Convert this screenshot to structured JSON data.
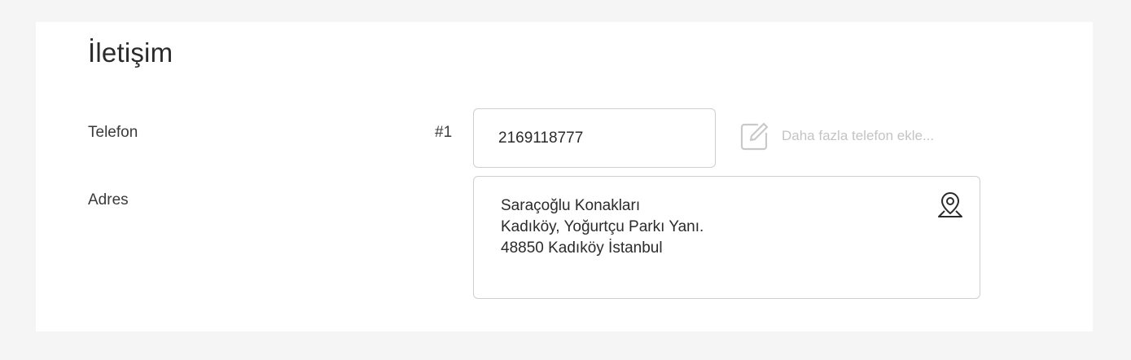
{
  "section": {
    "title": "İletişim"
  },
  "phone": {
    "label": "Telefon",
    "index_label": "#1",
    "value": "2169118777",
    "add_more_label": "Daha fazla telefon ekle...",
    "add_more_icon": "edit-icon"
  },
  "address": {
    "label": "Adres",
    "lines": [
      "Saraçoğlu Konakları",
      "Kadıköy, Yoğurtçu Parkı Yanı.",
      "48850 Kadıköy İstanbul"
    ],
    "map_icon": "map-pin-icon"
  },
  "colors": {
    "background": "#f5f5f6",
    "card": "#ffffff",
    "border": "#cfcfcf",
    "text": "#2b2b2b",
    "muted": "#c4c4c4"
  }
}
